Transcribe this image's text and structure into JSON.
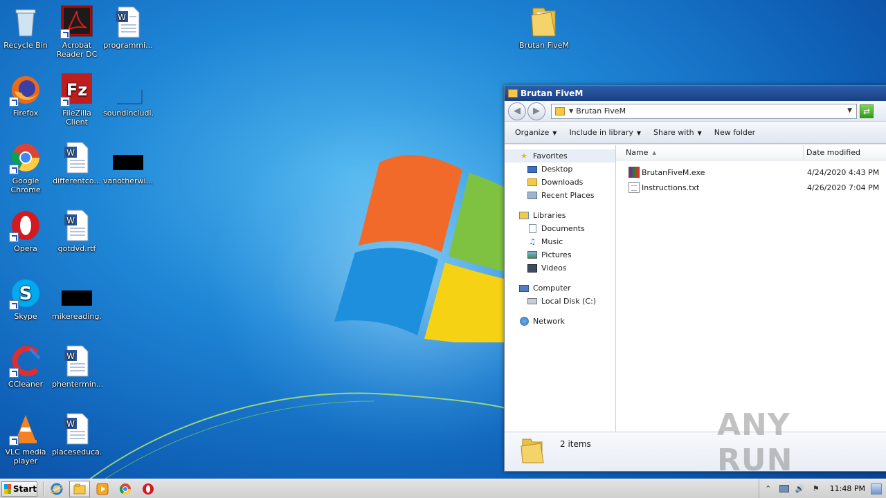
{
  "desktop": {
    "icons": [
      {
        "label": "Recycle Bin",
        "icon": "recycle-bin-icon"
      },
      {
        "label": "Acrobat Reader DC",
        "icon": "acrobat-reader-icon"
      },
      {
        "label": "programmi...",
        "icon": "word-document-icon"
      },
      {
        "label": "Firefox",
        "icon": "firefox-icon"
      },
      {
        "label": "FileZilla Client",
        "icon": "filezilla-icon"
      },
      {
        "label": "soundincludi...",
        "icon": "blank-file-icon"
      },
      {
        "label": "Google Chrome",
        "icon": "chrome-icon"
      },
      {
        "label": "differentco...",
        "icon": "word-document-icon"
      },
      {
        "label": "vanotherwi...",
        "icon": "black-thumbnail-icon"
      },
      {
        "label": "Opera",
        "icon": "opera-icon"
      },
      {
        "label": "gotdvd.rtf",
        "icon": "word-document-icon"
      },
      {
        "label": "Skype",
        "icon": "skype-icon"
      },
      {
        "label": "mikereading...",
        "icon": "black-thumbnail-icon"
      },
      {
        "label": "CCleaner",
        "icon": "ccleaner-icon"
      },
      {
        "label": "phentermin...",
        "icon": "word-document-icon"
      },
      {
        "label": "VLC media player",
        "icon": "vlc-icon"
      },
      {
        "label": "placeseduca...",
        "icon": "word-document-icon"
      },
      {
        "label": "Brutan FiveM",
        "icon": "folder-icon"
      }
    ]
  },
  "explorer": {
    "title": "Brutan FiveM",
    "address": "Brutan FiveM",
    "commands": {
      "organize": "Organize",
      "include": "Include in library",
      "share": "Share with",
      "new_folder": "New folder"
    },
    "nav": {
      "favorites": "Favorites",
      "desktop": "Desktop",
      "downloads": "Downloads",
      "recent": "Recent Places",
      "libraries": "Libraries",
      "documents": "Documents",
      "music": "Music",
      "pictures": "Pictures",
      "videos": "Videos",
      "computer": "Computer",
      "local_disk": "Local Disk (C:)",
      "network": "Network"
    },
    "columns": {
      "name": "Name",
      "date": "Date modified"
    },
    "files": [
      {
        "name": "BrutanFiveM.exe",
        "date": "4/24/2020 4:43 PM"
      },
      {
        "name": "Instructions.txt",
        "date": "4/26/2020 7:04 PM"
      }
    ],
    "status": "2 items"
  },
  "watermark": "ANY RUN",
  "taskbar": {
    "start": "Start",
    "clock": "11:48 PM"
  }
}
